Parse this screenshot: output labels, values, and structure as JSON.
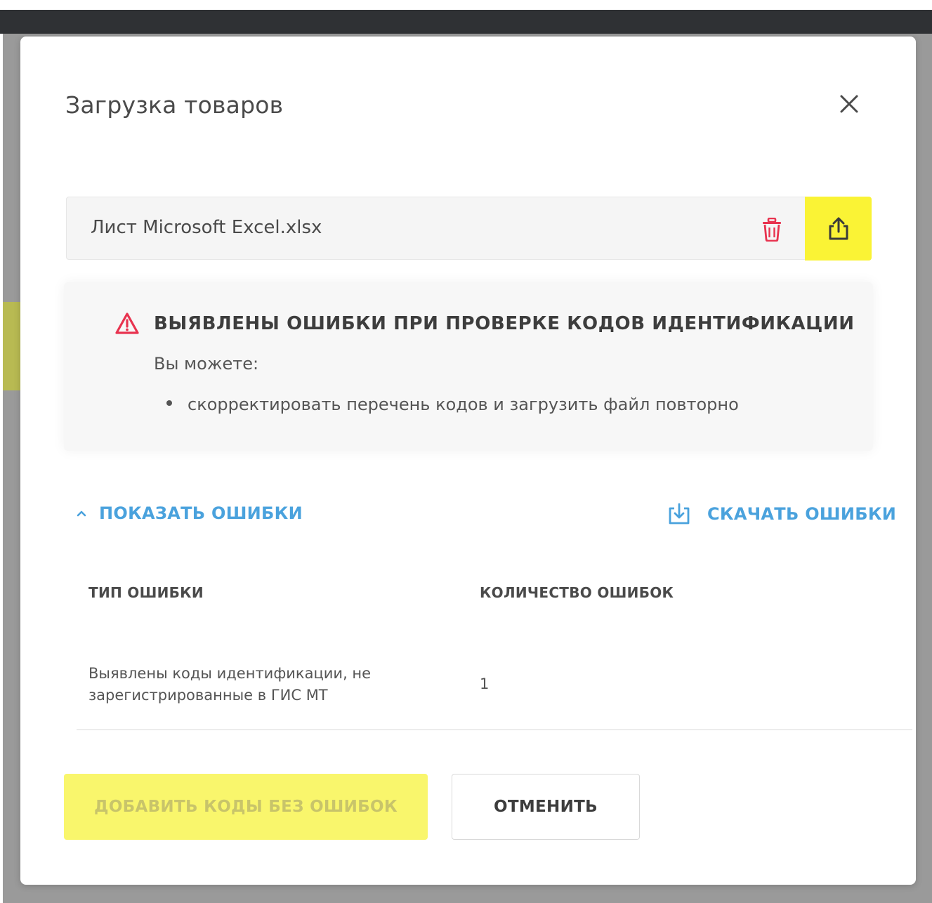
{
  "modal": {
    "title": "Загрузка товаров"
  },
  "file": {
    "name": "Лист Microsoft Excel.xlsx"
  },
  "alert": {
    "title": "ВЫЯВЛЕНЫ ОШИБКИ ПРИ ПРОВЕРКЕ КОДОВ ИДЕНТИФИКАЦИИ",
    "subtitle": "Вы можете:",
    "bullets": [
      "скорректировать перечень кодов и загрузить файл повторно"
    ]
  },
  "errors": {
    "show_label": "ПОКАЗАТЬ ОШИБКИ",
    "download_label": "СКАЧАТЬ ОШИБКИ"
  },
  "table": {
    "headers": [
      "ТИП ОШИБКИ",
      "КОЛИЧЕСТВО ОШИБОК"
    ],
    "rows": [
      {
        "type": "Выявлены коды идентификации, не зарегистрированные в ГИС МТ",
        "count": "1"
      }
    ]
  },
  "actions": {
    "add_label": "ДОБАВИТЬ КОДЫ БЕЗ ОШИБОК",
    "cancel_label": "ОТМЕНИТЬ"
  },
  "colors": {
    "accent_yellow": "#faf335",
    "link_blue": "#4aa2dd",
    "danger_red": "#e8334f",
    "topbar": "#2f3134"
  },
  "icons": {
    "close": "close-icon",
    "delete": "trash-icon",
    "upload": "upload-icon",
    "warning": "warning-triangle-icon",
    "chevron": "chevron-up-icon",
    "download": "download-icon"
  }
}
